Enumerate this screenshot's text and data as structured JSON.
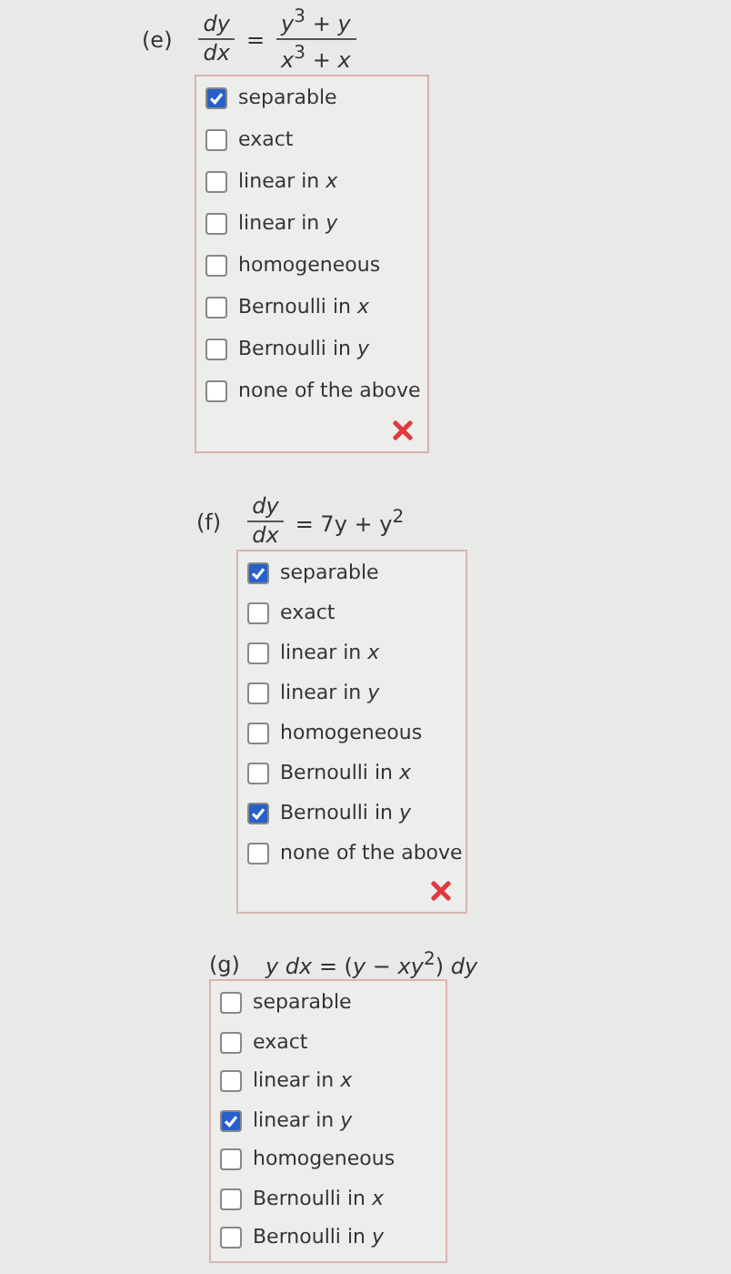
{
  "questions": [
    {
      "label": "(e)",
      "equation": [
        {
          "kind": "fraction",
          "num": "*dy*",
          "den": "*dx*"
        },
        {
          "kind": "text",
          "text": "="
        },
        {
          "kind": "fraction",
          "num": "*y*$^{3}$ + *y*",
          "den": "*x*$^{3}$ + *x*"
        }
      ],
      "options": [
        {
          "label": "separable",
          "checked": true
        },
        {
          "label": "exact",
          "checked": false
        },
        {
          "label": "linear in *x*",
          "checked": false
        },
        {
          "label": "linear in *y*",
          "checked": false
        },
        {
          "label": "homogeneous",
          "checked": false
        },
        {
          "label": "Bernoulli in *x*",
          "checked": false
        },
        {
          "label": "Bernoulli in *y*",
          "checked": false
        },
        {
          "label": "none of the above",
          "checked": false
        }
      ],
      "incorrect": true
    },
    {
      "label": "(f)",
      "equation": [
        {
          "kind": "fraction",
          "num": "*dy*",
          "den": "*dx*"
        },
        {
          "kind": "text",
          "text": "= 7y + y$^{2}$"
        }
      ],
      "options": [
        {
          "label": "separable",
          "checked": true
        },
        {
          "label": "exact",
          "checked": false
        },
        {
          "label": "linear in *x*",
          "checked": false
        },
        {
          "label": "linear in *y*",
          "checked": false
        },
        {
          "label": "homogeneous",
          "checked": false
        },
        {
          "label": "Bernoulli in *x*",
          "checked": false
        },
        {
          "label": "Bernoulli in *y*",
          "checked": true
        },
        {
          "label": "none of the above",
          "checked": false
        }
      ],
      "incorrect": true
    },
    {
      "label": "(g)",
      "equation": [
        {
          "kind": "text",
          "text": "*y dx* = (*y* − *xy*$^{2}$) *dy*"
        }
      ],
      "options": [
        {
          "label": "separable",
          "checked": false
        },
        {
          "label": "exact",
          "checked": false
        },
        {
          "label": "linear in *x*",
          "checked": false
        },
        {
          "label": "linear in *y*",
          "checked": true
        },
        {
          "label": "homogeneous",
          "checked": false
        },
        {
          "label": "Bernoulli in *x*",
          "checked": false
        },
        {
          "label": "Bernoulli in *y*",
          "checked": false
        }
      ]
    }
  ]
}
